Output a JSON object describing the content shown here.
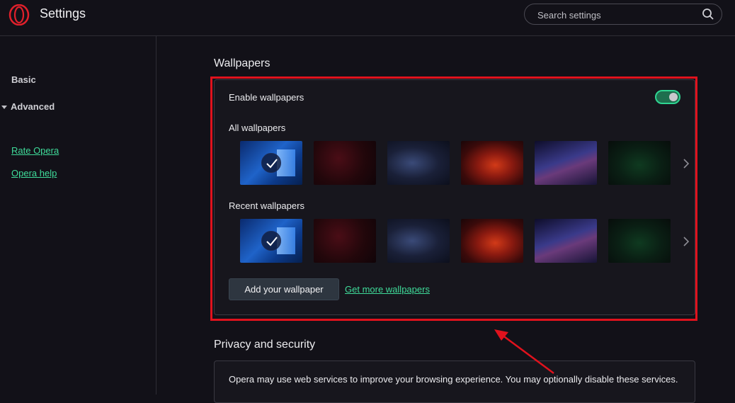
{
  "header": {
    "title": "Settings",
    "search_placeholder": "Search settings"
  },
  "sidebar": {
    "basic_label": "Basic",
    "advanced_label": "Advanced",
    "links": [
      "Rate Opera",
      "Opera help"
    ]
  },
  "wallpapers": {
    "section_title": "Wallpapers",
    "enable_label": "Enable wallpapers",
    "enabled": true,
    "all_label": "All wallpapers",
    "recent_label": "Recent wallpapers",
    "selected_index": 0,
    "add_button": "Add your wallpaper",
    "more_link": "Get more wallpapers"
  },
  "privacy": {
    "section_title": "Privacy and security",
    "description": "Opera may use web services to improve your browsing experience. You may optionally disable these services."
  },
  "colors": {
    "accent_green": "#3fdc9a",
    "highlight_red": "#e0121d",
    "opera_red": "#e0202b"
  }
}
